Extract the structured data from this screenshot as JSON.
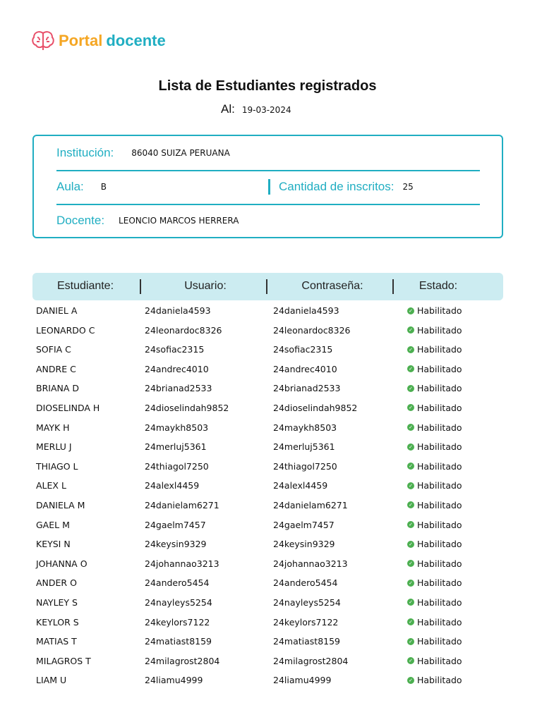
{
  "logo": {
    "part1": "Portal",
    "part2": "docente"
  },
  "title": "Lista de Estudiantes registrados",
  "date": {
    "label": "Al:",
    "value": "19-03-2024"
  },
  "info": {
    "institution_label": "Institución:",
    "institution": "86040 SUIZA PERUANA",
    "classroom_label": "Aula:",
    "classroom": "B",
    "count_label": "Cantidad de inscritos:",
    "count": "25",
    "teacher_label": "Docente:",
    "teacher": "LEONCIO MARCOS HERRERA"
  },
  "colors": {
    "accent": "#20aec2",
    "brand_orange": "#f5a623",
    "header_bg": "#ccecf1",
    "ok": "#4caf50"
  },
  "table": {
    "headers": [
      "Estudiante:",
      "Usuario:",
      "Contraseña:",
      "Estado:"
    ],
    "rows": [
      [
        "DANIEL A",
        "24daniela4593",
        "24daniela4593",
        "Habilitado"
      ],
      [
        "LEONARDO C",
        "24leonardoc8326",
        "24leonardoc8326",
        "Habilitado"
      ],
      [
        "SOFIA C",
        "24sofiac2315",
        "24sofiac2315",
        "Habilitado"
      ],
      [
        "ANDRE C",
        "24andrec4010",
        "24andrec4010",
        "Habilitado"
      ],
      [
        "BRIANA D",
        "24brianad2533",
        "24brianad2533",
        "Habilitado"
      ],
      [
        "DIOSELINDA H",
        "24dioselindah9852",
        "24dioselindah9852",
        "Habilitado"
      ],
      [
        "MAYK H",
        "24maykh8503",
        "24maykh8503",
        "Habilitado"
      ],
      [
        "MERLU J",
        "24merluj5361",
        "24merluj5361",
        "Habilitado"
      ],
      [
        "THIAGO L",
        "24thiagol7250",
        "24thiagol7250",
        "Habilitado"
      ],
      [
        "ALEX L",
        "24alexl4459",
        "24alexl4459",
        "Habilitado"
      ],
      [
        "DANIELA M",
        "24danielam6271",
        "24danielam6271",
        "Habilitado"
      ],
      [
        "GAEL M",
        "24gaelm7457",
        "24gaelm7457",
        "Habilitado"
      ],
      [
        "KEYSI N",
        "24keysin9329",
        "24keysin9329",
        "Habilitado"
      ],
      [
        "JOHANNA O",
        "24johannao3213",
        "24johannao3213",
        "Habilitado"
      ],
      [
        "ANDER O",
        "24andero5454",
        "24andero5454",
        "Habilitado"
      ],
      [
        "NAYLEY S",
        "24nayleys5254",
        "24nayleys5254",
        "Habilitado"
      ],
      [
        "KEYLOR S",
        "24keylors7122",
        "24keylors7122",
        "Habilitado"
      ],
      [
        "MATIAS T",
        "24matiast8159",
        "24matiast8159",
        "Habilitado"
      ],
      [
        "MILAGROS T",
        "24milagrost2804",
        "24milagrost2804",
        "Habilitado"
      ],
      [
        "LIAM U",
        "24liamu4999",
        "24liamu4999",
        "Habilitado"
      ]
    ]
  }
}
